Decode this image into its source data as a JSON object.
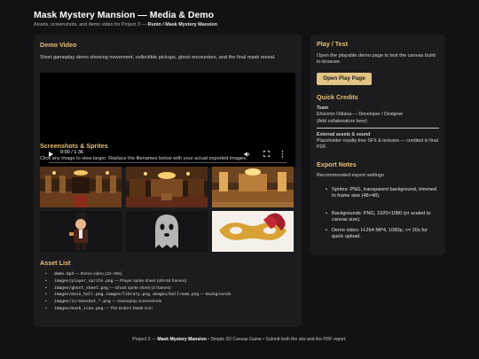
{
  "header": {
    "title": "Mask Mystery Mansion — Media & Demo",
    "subtitle_prefix": "Assets, screenshots, and demo video for Project 3 — ",
    "subtitle_bold": "Runin / Mask Mystery Mansion"
  },
  "demo_video": {
    "heading": "Demo Video",
    "description": "Short gameplay demo showing movement, collectible pickups, ghost encounters, and the final mask reveal.",
    "time": "0:00 / 1:36",
    "controls": [
      "play-icon",
      "volume-icon",
      "fullscreen-icon",
      "more-icon"
    ]
  },
  "screenshots": {
    "heading": "Screenshots & Sprites",
    "description": "Click any image to view larger. Replace the filenames below with your actual exported images.",
    "items": [
      {
        "name": "main-hall-screenshot"
      },
      {
        "name": "library-screenshot"
      },
      {
        "name": "ballroom-screenshot"
      },
      {
        "name": "player-sprite"
      },
      {
        "name": "ghost-sprite"
      },
      {
        "name": "mask-icon"
      }
    ]
  },
  "assets": {
    "heading": "Asset List",
    "items": [
      {
        "code": "demo.mp4",
        "desc": " — Demo video (10–30s)"
      },
      {
        "code": "images/player_sprite.png",
        "desc": " — Player sprite sheet (48×48 frames)"
      },
      {
        "code": "images/ghost_sheet.png",
        "desc": " — Ghost sprite sheet (4 frames)"
      },
      {
        "code": "images/main_hall.png",
        "code2": "images/library.png",
        "code3": "images/ballroom.png",
        "desc": " — Backgrounds"
      },
      {
        "code": "images/screenshot_*.png",
        "desc": " — Gameplay screenshots"
      },
      {
        "code": "images/mask_icon.png",
        "desc": " — The Duke's Mask icon"
      }
    ]
  },
  "play": {
    "heading": "Play / Test",
    "description": "Open the playable demo page to test the canvas build in-browser.",
    "button": "Open Play Page"
  },
  "credits": {
    "heading": "Quick Credits",
    "team_label": "Team",
    "team_line1": "Ehizomo Odiana — Developer / Designer",
    "team_line2": "(Add collaborators here)",
    "ext_label": "External assets & sound",
    "ext_text": "Placeholder royalty-free SFX & textures — credited in final PDF."
  },
  "export_notes": {
    "heading": "Export Notes",
    "intro": "Recommended export settings",
    "bullets": [
      "Sprites: PNG, transparent background, trimmed to frame size (48×48).",
      "Backgrounds: PNG, 1920×1080 (or scaled to canvas size).",
      "Demo video: H.264 MP4, 1080p, <= 20s for quick upload."
    ]
  },
  "footer": {
    "prefix": "Project 3 — ",
    "bold": "Mask Mystery Mansion",
    "suffix": " • Simple 2D Canvas Game • Submit both the site and the PDF report."
  },
  "colors": {
    "accent": "#e9c074",
    "button": "#e2c483",
    "panel": "#1c1c1f",
    "background": "#121214"
  }
}
